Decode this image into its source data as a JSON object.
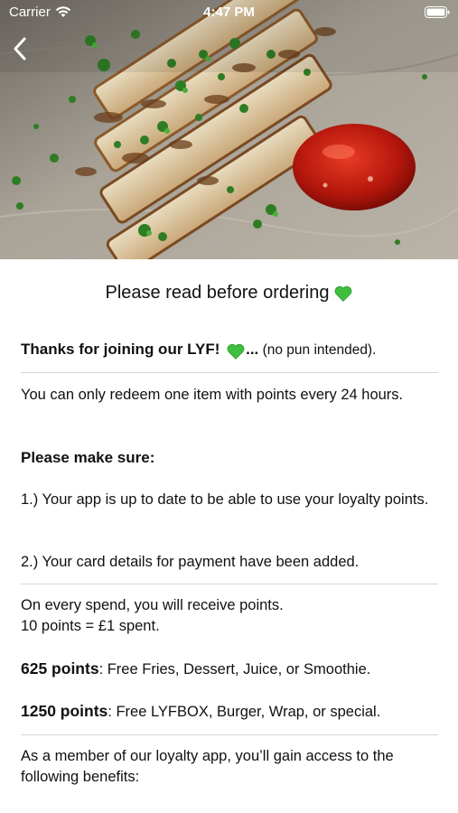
{
  "status_bar": {
    "carrier": "Carrier",
    "time": "4:47 PM"
  },
  "hero": {
    "image": "grilled-halloumi-with-parsley-and-chilli-sauce"
  },
  "page_title": "Please read before ordering",
  "intro": {
    "bold": "Thanks for joining our LYF!",
    "bold_suffix": "...",
    "normal": " (no pun intended)."
  },
  "redeem_notice": "You can only redeem one item with points every 24 hours.",
  "make_sure": {
    "heading": "Please make sure:",
    "item_1": "1.) Your app is up to date to be able to use your loyalty points.",
    "item_2": "2.) Your card details for payment have been added."
  },
  "earn": {
    "line_1": "On every spend, you will receive points.",
    "line_2": "10 points = £1 spent."
  },
  "rewards": [
    {
      "points": "625 points",
      "description": ": Free Fries, Dessert, Juice, or Smoothie."
    },
    {
      "points": "1250 points",
      "description": ": Free LYFBOX, Burger, Wrap, or special."
    }
  ],
  "benefits_intro": "As a member of our loyalty app, you’ll gain access to the following benefits:",
  "colors": {
    "heart": "#3fbf3f",
    "divider": "#d6d6d6",
    "text": "#111111"
  }
}
